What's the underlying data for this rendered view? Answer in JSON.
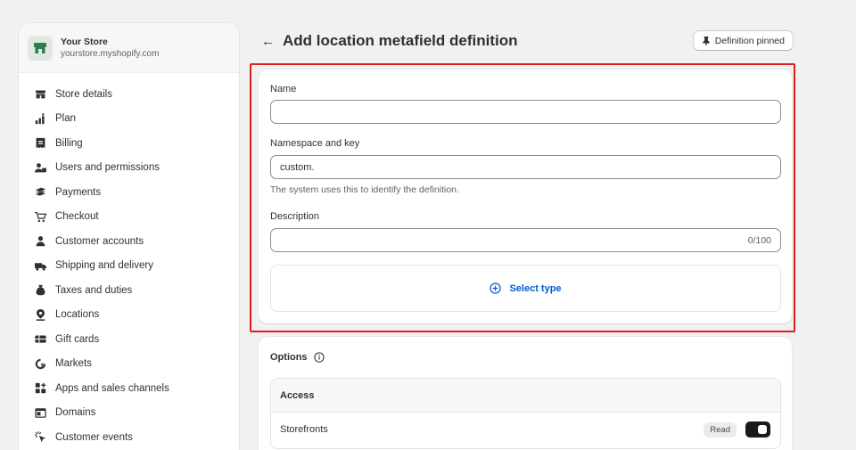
{
  "store": {
    "name": "Your Store",
    "domain": "yourstore.myshopify.com"
  },
  "sidebar": {
    "items": [
      {
        "label": "Store details",
        "icon": "store-icon"
      },
      {
        "label": "Plan",
        "icon": "plan-icon"
      },
      {
        "label": "Billing",
        "icon": "billing-icon"
      },
      {
        "label": "Users and permissions",
        "icon": "users-icon"
      },
      {
        "label": "Payments",
        "icon": "payments-icon"
      },
      {
        "label": "Checkout",
        "icon": "cart-icon"
      },
      {
        "label": "Customer accounts",
        "icon": "person-icon"
      },
      {
        "label": "Shipping and delivery",
        "icon": "truck-icon"
      },
      {
        "label": "Taxes and duties",
        "icon": "tax-icon"
      },
      {
        "label": "Locations",
        "icon": "location-pin-icon"
      },
      {
        "label": "Gift cards",
        "icon": "gift-card-icon"
      },
      {
        "label": "Markets",
        "icon": "globe-icon"
      },
      {
        "label": "Apps and sales channels",
        "icon": "apps-icon"
      },
      {
        "label": "Domains",
        "icon": "domain-icon"
      },
      {
        "label": "Customer events",
        "icon": "cursor-click-icon"
      }
    ]
  },
  "header": {
    "title": "Add location metafield definition",
    "pin_label": "Definition pinned"
  },
  "form": {
    "name_label": "Name",
    "name_value": "",
    "namespace_label": "Namespace and key",
    "namespace_value": "custom.",
    "namespace_help": "The system uses this to identify the definition.",
    "description_label": "Description",
    "description_value": "",
    "description_counter": "0/100",
    "select_type_label": "Select type"
  },
  "options": {
    "title": "Options",
    "access_header": "Access",
    "rows": [
      {
        "label": "Storefronts",
        "badge": "Read",
        "enabled": true
      }
    ]
  },
  "colors": {
    "accent": "#005bd3",
    "highlight": "#e11d1d",
    "toggle_on": "#1a1a1a"
  }
}
